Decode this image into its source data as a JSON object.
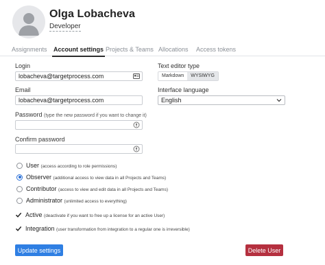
{
  "profile": {
    "name": "Olga  Lobacheva",
    "role": "Developer"
  },
  "tabs": [
    {
      "label": "Assignments",
      "active": false
    },
    {
      "label": "Account settings",
      "active": true
    },
    {
      "label": "Projects & Teams",
      "active": false
    },
    {
      "label": "Allocations",
      "active": false
    },
    {
      "label": "Access tokens",
      "active": false
    }
  ],
  "form": {
    "login_label": "Login",
    "login_value": "lobacheva@targetprocess.com",
    "email_label": "Email",
    "email_value": "lobacheva@targetprocess.com",
    "password_label": "Password",
    "password_hint": "(type the new password if you want to change it)",
    "confirm_label": "Confirm password",
    "editor_type_label": "Text editor type",
    "editor_options": [
      "Markdown",
      "WYSIWYG"
    ],
    "editor_selected": "WYSIWYG",
    "language_label": "Interface language",
    "language_value": "English"
  },
  "roles": [
    {
      "name": "User",
      "desc": "(access according to role permissions)",
      "selected": false
    },
    {
      "name": "Observer",
      "desc": "(additional access to view data in all Projects and Teams)",
      "selected": true
    },
    {
      "name": "Contributor",
      "desc": "(access to view and edit data in all Projects and Teams)",
      "selected": false
    },
    {
      "name": "Administrator",
      "desc": "(unlimited access to everything)",
      "selected": false
    }
  ],
  "flags": [
    {
      "name": "Active",
      "desc": "(deactivate if you want to free up a license for an active User)",
      "checked": true
    },
    {
      "name": "Integration",
      "desc": "(user transformation from integration to a regular one is irreversible)",
      "checked": true
    }
  ],
  "buttons": {
    "update": "Update settings",
    "delete": "Delete User"
  },
  "colors": {
    "primary": "#2f7fe3",
    "danger": "#b5303f",
    "radio_selected": "#2a6fd6"
  }
}
